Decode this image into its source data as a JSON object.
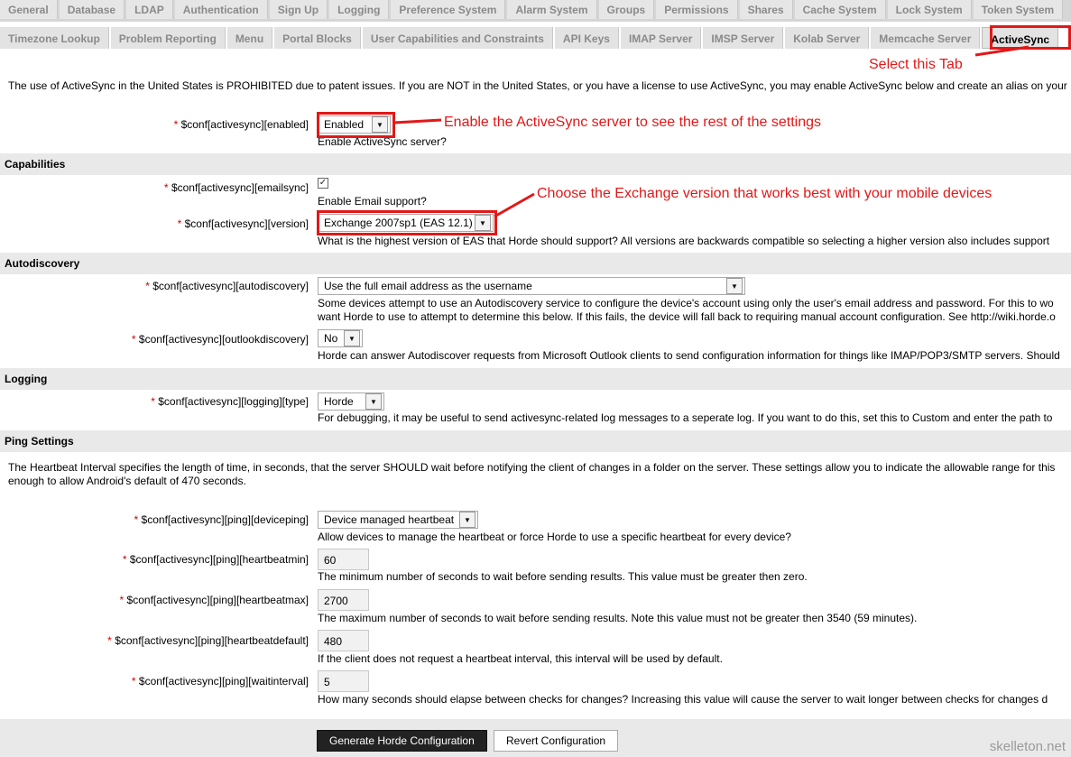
{
  "tabs_row1": [
    "General",
    "Database",
    "LDAP",
    "Authentication",
    "Sign Up",
    "Logging",
    "Preference System",
    "Alarm System",
    "Groups",
    "Permissions",
    "Shares",
    "Cache System",
    "Lock System",
    "Token System"
  ],
  "tabs_row2": [
    "Timezone Lookup",
    "Problem Reporting",
    "Menu",
    "Portal Blocks",
    "User Capabilities and Constraints",
    "API Keys",
    "IMAP Server",
    "IMSP Server",
    "Kolab Server",
    "Memcache Server",
    "ActiveSync"
  ],
  "intro": "The use of ActiveSync in the United States is PROHIBITED due to patent issues. If you are NOT in the United States, or you have a license to use ActiveSync, you may enable ActiveSync below and create an alias on your",
  "required_mark": "*",
  "fields": {
    "enabled": {
      "label": "$conf[activesync][enabled]",
      "value": "Enabled",
      "desc": "Enable ActiveSync server?"
    },
    "emailsync": {
      "label": "$conf[activesync][emailsync]",
      "checked": "✓",
      "desc": "Enable Email support?"
    },
    "version": {
      "label": "$conf[activesync][version]",
      "value": "Exchange 2007sp1 (EAS 12.1)",
      "desc": "What is the highest version of EAS that Horde should support? All versions are backwards compatible so selecting a higher version also includes support"
    },
    "autodiscovery": {
      "label": "$conf[activesync][autodiscovery]",
      "value": "Use the full email address as the username",
      "desc1": "Some devices attempt to use an Autodiscovery service to configure the device's account using only the user's email address and password. For this to wo",
      "desc2": "want Horde to use to attempt to determine this below. If this fails, the device will fall back to requiring manual account configuration. See http://wiki.horde.o"
    },
    "outlookdiscovery": {
      "label": "$conf[activesync][outlookdiscovery]",
      "value": "No",
      "desc": "Horde can answer Autodiscover requests from Microsoft Outlook clients to send configuration information for things like IMAP/POP3/SMTP servers. Should"
    },
    "logging_type": {
      "label": "$conf[activesync][logging][type]",
      "value": "Horde",
      "desc": "For debugging, it may be useful to send activesync-related log messages to a seperate log. If you want to do this, set this to Custom and enter the path to"
    },
    "deviceping": {
      "label": "$conf[activesync][ping][deviceping]",
      "value": "Device managed heartbeat",
      "desc": "Allow devices to manage the heartbeat or force Horde to use a specific heartbeat for every device?"
    },
    "heartbeatmin": {
      "label": "$conf[activesync][ping][heartbeatmin]",
      "value": "60",
      "desc": "The minimum number of seconds to wait before sending results. This value must be greater then zero."
    },
    "heartbeatmax": {
      "label": "$conf[activesync][ping][heartbeatmax]",
      "value": "2700",
      "desc": "The maximum number of seconds to wait before sending results. Note this value must not be greater then 3540 (59 minutes)."
    },
    "heartbeatdefault": {
      "label": "$conf[activesync][ping][heartbeatdefault]",
      "value": "480",
      "desc": "If the client does not request a heartbeat interval, this interval will be used by default."
    },
    "waitinterval": {
      "label": "$conf[activesync][ping][waitinterval]",
      "value": "5",
      "desc": "How many seconds should elapse between checks for changes? Increasing this value will cause the server to wait longer between checks for changes d"
    }
  },
  "sections": {
    "capabilities": "Capabilities",
    "autodiscovery": "Autodiscovery",
    "logging": "Logging",
    "ping": "Ping Settings"
  },
  "ping_intro1": "The Heartbeat Interval specifies the length of time, in seconds, that the server SHOULD wait before notifying the client of changes in a folder on the server. These settings allow you to indicate the allowable range for this",
  "ping_intro2": "enough to allow Android's default of 470 seconds.",
  "annotations": {
    "tab": "Select this Tab",
    "enable": "Enable the ActiveSync server to see the rest of the settings",
    "version": "Choose the Exchange version that works best with your mobile devices"
  },
  "buttons": {
    "generate": "Generate Horde Configuration",
    "revert": "Revert Configuration"
  },
  "watermark": "skelleton.net",
  "colors": {
    "annotation": "#e21818",
    "required": "#cc0000"
  }
}
